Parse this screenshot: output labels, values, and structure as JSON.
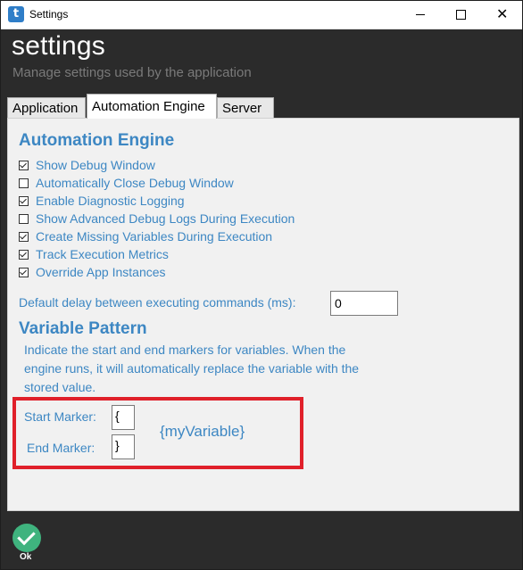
{
  "window": {
    "title": "Settings",
    "app_icon_letter": "t",
    "close_glyph": "✕"
  },
  "header": {
    "title": "settings",
    "subtitle": "Manage settings used by the application"
  },
  "tabs": [
    {
      "label": "Application"
    },
    {
      "label": "Automation Engine",
      "selected": true
    },
    {
      "label": "Server"
    }
  ],
  "automation_engine": {
    "section_title": "Automation Engine",
    "options": [
      {
        "label": "Show Debug Window",
        "checked": true
      },
      {
        "label": "Automatically Close Debug Window",
        "checked": false
      },
      {
        "label": "Enable Diagnostic Logging",
        "checked": true
      },
      {
        "label": "Show Advanced Debug Logs During Execution",
        "checked": false
      },
      {
        "label": "Create Missing Variables During Execution",
        "checked": true
      },
      {
        "label": "Track Execution Metrics",
        "checked": true
      },
      {
        "label": "Override App Instances",
        "checked": true
      }
    ],
    "delay_label": "Default delay between executing commands (ms):",
    "delay_value": "0"
  },
  "variable_pattern": {
    "section_title": "Variable Pattern",
    "description": "Indicate the start and end markers for variables.  When the engine runs, it will automatically replace the variable with the stored value.",
    "start_label": "Start Marker:",
    "start_value": "{",
    "end_label": "End Marker:",
    "end_value": "}",
    "preview": "{myVariable}"
  },
  "footer": {
    "ok_label": "Ok"
  },
  "colors": {
    "accent": "#3d87c3",
    "highlight": "#e0202a",
    "ok_green": "#3fb37e",
    "background": "#2b2b2b"
  }
}
